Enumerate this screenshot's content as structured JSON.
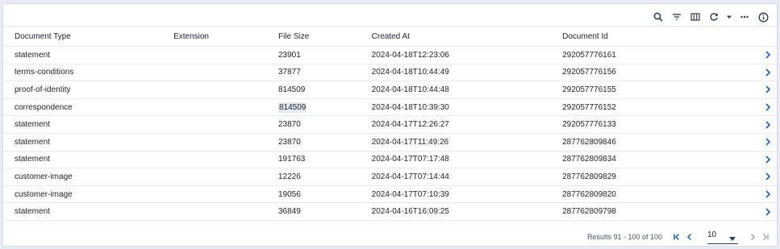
{
  "toolbar": {
    "icons": [
      "search-icon",
      "filter-icon",
      "columns-icon",
      "refresh-icon",
      "dropdown-caret-icon",
      "more-icon",
      "info-icon"
    ]
  },
  "table": {
    "columns": [
      "Document Type",
      "Extension",
      "File Size",
      "Created At",
      "Document Id"
    ],
    "rows": [
      {
        "type": "statement",
        "extension": "",
        "size": "23901",
        "created": "2024-04-18T12:23:06",
        "id": "292057776161"
      },
      {
        "type": "terms-conditions",
        "extension": "",
        "size": "37877",
        "created": "2024-04-18T10:44:49",
        "id": "292057776156"
      },
      {
        "type": "proof-of-identity",
        "extension": "",
        "size": "814509",
        "created": "2024-04-18T10:44:48",
        "id": "292057776155"
      },
      {
        "type": "correspondence",
        "extension": "",
        "size": "814509",
        "created": "2024-04-18T10:39:30",
        "id": "292057776152"
      },
      {
        "type": "statement",
        "extension": "",
        "size": "23870",
        "created": "2024-04-17T12:26:27",
        "id": "292057776133"
      },
      {
        "type": "statement",
        "extension": "",
        "size": "23870",
        "created": "2024-04-17T11:49:26",
        "id": "287762809846"
      },
      {
        "type": "statement",
        "extension": "",
        "size": "191763",
        "created": "2024-04-17T07:17:48",
        "id": "287762809834"
      },
      {
        "type": "customer-image",
        "extension": "",
        "size": "12226",
        "created": "2024-04-17T07:14:44",
        "id": "287762809829"
      },
      {
        "type": "customer-image",
        "extension": "",
        "size": "19056",
        "created": "2024-04-17T07:10:39",
        "id": "287762809820"
      },
      {
        "type": "statement",
        "extension": "",
        "size": "36849",
        "created": "2024-04-16T16:09:25",
        "id": "287762809798"
      }
    ]
  },
  "footer": {
    "results": "Results 91 - 100 of 100",
    "page_size": "10"
  },
  "colors": {
    "accent": "#1d5fb3",
    "background": "#e6ebf5"
  }
}
